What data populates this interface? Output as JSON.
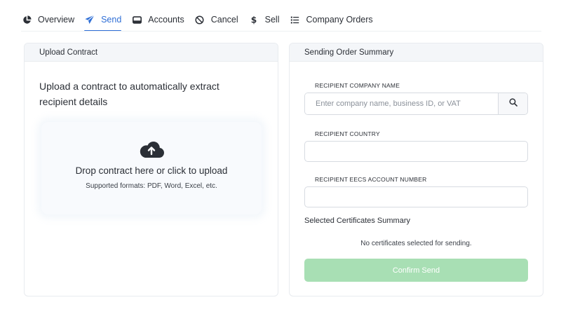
{
  "nav": {
    "items": [
      {
        "label": "Overview",
        "icon": "pie-chart-icon",
        "active": false
      },
      {
        "label": "Send",
        "icon": "paper-plane-icon",
        "active": true
      },
      {
        "label": "Accounts",
        "icon": "wallet-icon",
        "active": false
      },
      {
        "label": "Cancel",
        "icon": "ban-icon",
        "active": false
      },
      {
        "label": "Sell",
        "icon": "dollar-icon",
        "active": false
      },
      {
        "label": "Company Orders",
        "icon": "list-icon",
        "active": false
      }
    ]
  },
  "upload": {
    "header": "Upload Contract",
    "title": "Upload a contract to automatically extract recipient details",
    "drop_text": "Drop contract here or click to upload",
    "formats": "Supported formats: PDF, Word, Excel, etc."
  },
  "summary": {
    "header": "Sending Order Summary",
    "company_label": "RECIPIENT COMPANY NAME",
    "company_placeholder": "Enter company name, business ID, or VAT",
    "company_value": "",
    "country_label": "RECIPIENT COUNTRY",
    "country_value": "",
    "eecs_label": "RECIPIENT EECS ACCOUNT NUMBER",
    "eecs_value": "",
    "certs_title": "Selected Certificates Summary",
    "no_certs": "No certificates selected for sending.",
    "confirm_label": "Confirm Send"
  },
  "colors": {
    "accent": "#2f6fd6",
    "confirm_disabled": "#a8dfb4",
    "header_bg": "#f4f6f9"
  }
}
